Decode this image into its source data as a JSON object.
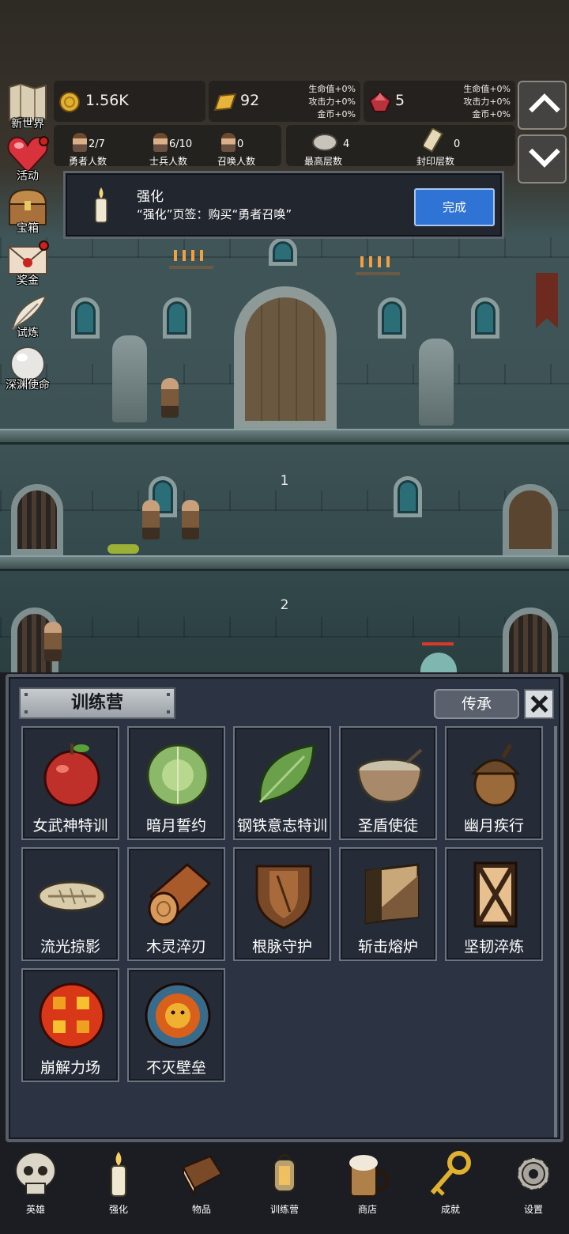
{
  "scene": {
    "floor_numbers": [
      "1",
      "2"
    ]
  },
  "side_menu": [
    {
      "label": "新世界",
      "icon": "map-icon",
      "dot": false
    },
    {
      "label": "活动",
      "icon": "heart-icon",
      "dot": true
    },
    {
      "label": "宝箱",
      "icon": "treasure-chest-icon",
      "dot": false
    },
    {
      "label": "奖金",
      "icon": "envelope-icon",
      "dot": true
    },
    {
      "label": "试炼",
      "icon": "feather-icon",
      "dot": false
    },
    {
      "label": "深渊使命",
      "icon": "pearl-icon",
      "dot": false
    }
  ],
  "resources": [
    {
      "icon": "gold-coin-icon",
      "value": "1.56K",
      "bonus": []
    },
    {
      "icon": "gold-bar-icon",
      "value": "92",
      "bonus": [
        "生命值+0%",
        "攻击力+0%",
        "金币+0%"
      ]
    },
    {
      "icon": "ruby-icon",
      "value": "5",
      "bonus": [
        "生命值+0%",
        "攻击力+0%",
        "金币+0%"
      ]
    }
  ],
  "counts": [
    {
      "label": "勇者人数",
      "value": "2/7"
    },
    {
      "label": "士兵人数",
      "value": "6/10"
    },
    {
      "label": "召唤人数",
      "value": "0"
    }
  ],
  "floors": [
    {
      "label": "最高层数",
      "value": "4",
      "icon": "stone-icon"
    },
    {
      "label": "封印层数",
      "value": "0",
      "icon": "scroll-icon"
    }
  ],
  "task": {
    "title": "强化",
    "desc": "“强化”页签：购买“勇者召唤”",
    "button": "完成",
    "icon": "candle-icon"
  },
  "panel": {
    "title": "训练营",
    "inherit_button": "传承",
    "items": [
      {
        "name": "女武神特训",
        "icon": "apple-icon"
      },
      {
        "name": "暗月誓约",
        "icon": "cabbage-icon"
      },
      {
        "name": "钢铁意志特训",
        "icon": "leaf-icon"
      },
      {
        "name": "圣盾使徒",
        "icon": "porridge-bowl-icon"
      },
      {
        "name": "幽月疾行",
        "icon": "acorn-icon"
      },
      {
        "name": "流光掠影",
        "icon": "fish-bone-icon"
      },
      {
        "name": "木灵淬刃",
        "icon": "wood-log-icon"
      },
      {
        "name": "根脉守护",
        "icon": "wooden-shield-icon"
      },
      {
        "name": "斩击熔炉",
        "icon": "block-icon"
      },
      {
        "name": "坚韧淬炼",
        "icon": "cross-shield-icon"
      },
      {
        "name": "崩解力场",
        "icon": "lava-grid-icon"
      },
      {
        "name": "不灭壁垒",
        "icon": "sun-orb-icon"
      }
    ]
  },
  "bottom_nav": [
    {
      "label": "英雄",
      "icon": "skull-icon"
    },
    {
      "label": "强化",
      "icon": "candle-icon"
    },
    {
      "label": "物品",
      "icon": "book-icon"
    },
    {
      "label": "训练营",
      "icon": "lantern-icon"
    },
    {
      "label": "商店",
      "icon": "beer-mug-icon"
    },
    {
      "label": "成就",
      "icon": "key-icon"
    },
    {
      "label": "设置",
      "icon": "gear-icon"
    }
  ],
  "colors": {
    "accent_button": "#2f74d4",
    "panel_bg": "#2c3444",
    "alert_dot": "#c8241e",
    "enemy_hp": "#d83a2a"
  }
}
